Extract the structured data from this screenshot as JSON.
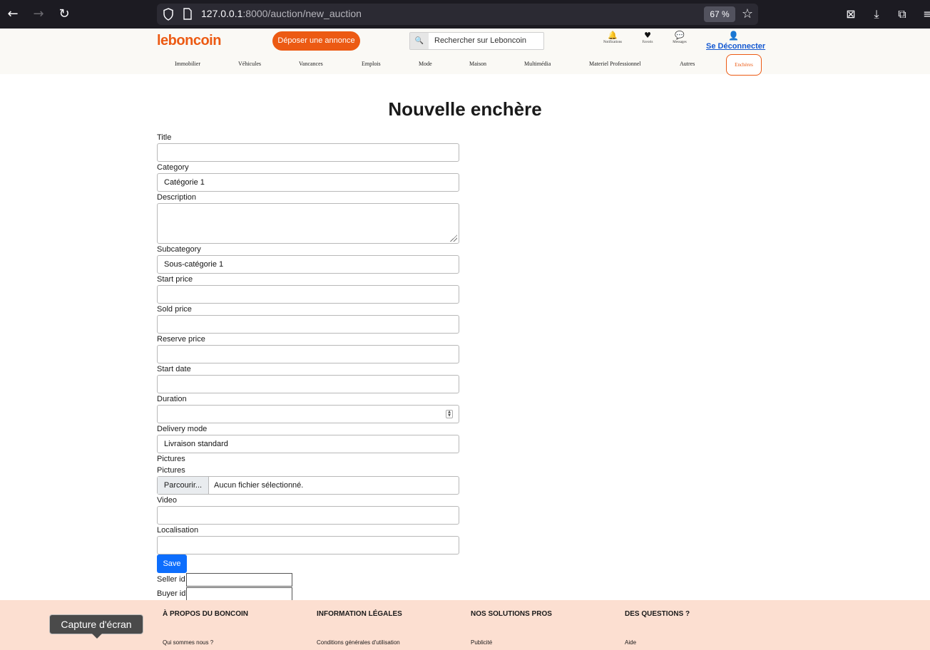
{
  "browser": {
    "url_host": "127.0.0.1",
    "url_rest": ":8000/auction/new_auction",
    "zoom": "67 %"
  },
  "header": {
    "logo": "leboncoin",
    "deposit_label": "Déposer une annonce",
    "search_placeholder": "Rechercher sur Leboncoin",
    "icons": {
      "notifications": "Notifications",
      "favoris": "Favoris",
      "messages": "Messages"
    },
    "logout_label": "Se Déconnecter",
    "categories": [
      "Immobilier",
      "Véhicules",
      "Vancances",
      "Emplois",
      "Mode",
      "Maison",
      "Multimédia",
      "Materiel Professionnel",
      "Autres"
    ],
    "active_category": "Enchères"
  },
  "form": {
    "title": "Nouvelle enchère",
    "labels": {
      "title": "Title",
      "category": "Category",
      "description": "Description",
      "subcategory": "Subcategory",
      "start_price": "Start price",
      "sold_price": "Sold price",
      "reserve_price": "Reserve price",
      "start_date": "Start date",
      "duration": "Duration",
      "delivery_mode": "Delivery mode",
      "pictures_section": "Pictures",
      "pictures": "Pictures",
      "video": "Video",
      "localisation": "Localisation",
      "seller_id": "Seller id",
      "buyer_id": "Buyer id"
    },
    "values": {
      "category": "Catégorie 1",
      "subcategory": "Sous-catégorie 1",
      "delivery_mode": "Livraison standard"
    },
    "file_button": "Parcourir...",
    "file_status": "Aucun fichier sélectionné.",
    "save_label": "Save"
  },
  "footer": {
    "columns": [
      {
        "heading": "À PROPOS DU BONCOIN",
        "link": "Qui sommes nous ?"
      },
      {
        "heading": "INFORMATION LÉGALES",
        "link": "Conditions générales d'utilisation"
      },
      {
        "heading": "NOS SOLUTIONS PROS",
        "link": "Publicité"
      },
      {
        "heading": "DES QUESTIONS ?",
        "link": "Aide"
      }
    ]
  },
  "tooltip": "Capture d'écran",
  "colors": {
    "brand": "#ec5a13",
    "link": "#1358d1",
    "save": "#0d6efd",
    "footer_bg": "#fcdfd1"
  }
}
